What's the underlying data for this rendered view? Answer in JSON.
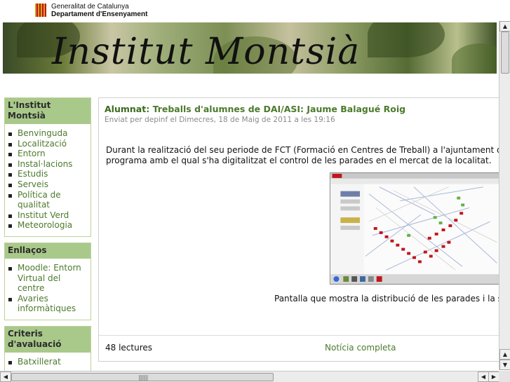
{
  "header": {
    "gencat_line1": "Generalitat de Catalunya",
    "gencat_line2": "Departament d'Ensenyament",
    "site_title": "Institut Montsià"
  },
  "sidebar": {
    "blocks": [
      {
        "title": "L'Institut Montsià",
        "items": [
          "Benvinguda",
          "Localització",
          "Entorn",
          "Instal·lacions",
          "Estudis",
          "Serveis",
          "Política de qualitat",
          "Institut Verd",
          "Meteorologia"
        ]
      },
      {
        "title": "Enllaços",
        "items": [
          "Moodle: Entorn Virtual del centre",
          "Avaries informàtiques"
        ]
      },
      {
        "title": "Criteris d'avaluació",
        "items": [
          "Batxillerat"
        ]
      }
    ]
  },
  "node": {
    "category": "Alumnat",
    "title": "Treballs d'alumnes de DAI/ASI: Jaume Balagué Roig",
    "meta": "Enviat per depinf el Dimecres, 18 de Maig de 2011 a les 19:16",
    "body_line1": "Durant la realització del seu periode de FCT (Formació en Centres de Treball) a l'ajuntament de la S",
    "body_line2": "programa amb el qual s'ha digitalitzat el control de les parades en el mercat de la localitat.",
    "caption": "Pantalla que mostra la distribució de les parades i la sev",
    "reads": "48 lectures",
    "more_link": "Notícia completa"
  },
  "colors": {
    "link_green": "#4c7a2c",
    "block_header": "#a9c98a",
    "meta_grey": "#8a8a8a"
  },
  "icons": {
    "scroll_up": "▲",
    "scroll_down": "▼",
    "scroll_left": "◀",
    "scroll_right": "▶",
    "grip": "||||||||"
  }
}
